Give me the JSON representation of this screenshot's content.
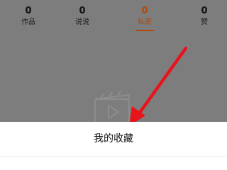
{
  "profile_stats": [
    {
      "count": "0",
      "label": "作品"
    },
    {
      "count": "0",
      "label": "说说"
    },
    {
      "count": "0",
      "label": "私密"
    },
    {
      "count": "0",
      "label": "赞"
    }
  ],
  "active_stat": "私密",
  "action_sheet": {
    "options": [
      {
        "label": "我的收藏"
      }
    ]
  },
  "colors": {
    "accent": "#b24a0c",
    "overlay": "#7d7d7d",
    "arrow": "#e8141c",
    "sheet": "#ffffff"
  },
  "icons": {
    "empty_state": "video-clapperboard-icon",
    "annotation": "arrow-pointing-to-option"
  }
}
